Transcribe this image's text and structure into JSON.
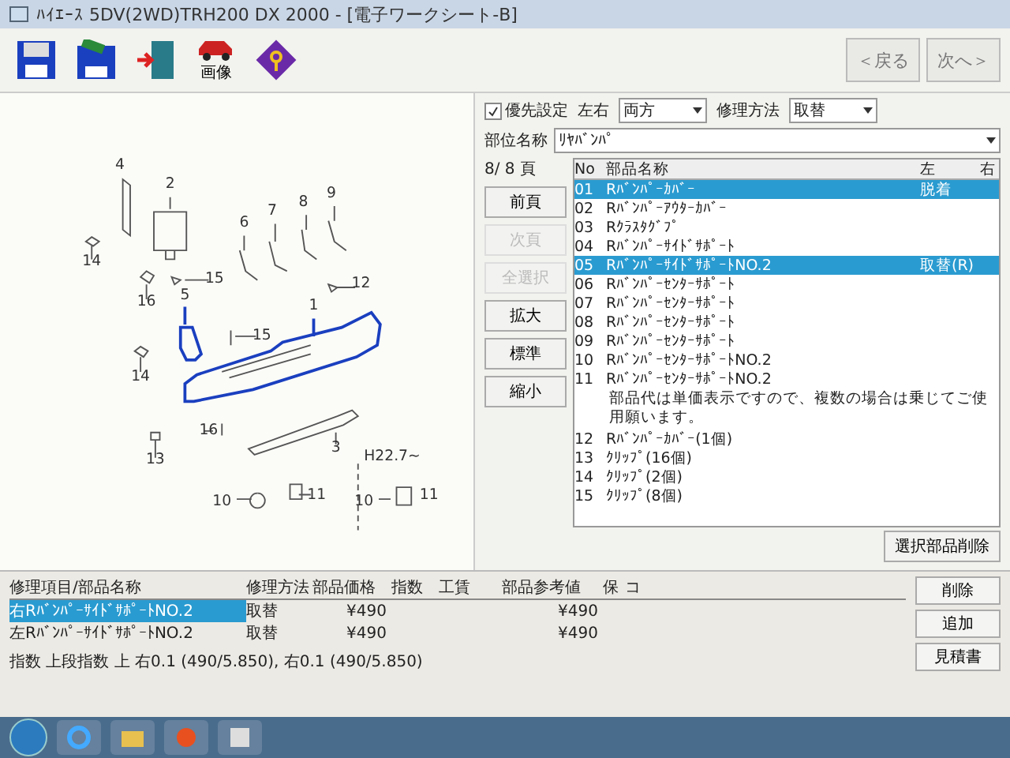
{
  "window": {
    "title": "ﾊｲｴｰｽ 5DV(2WD)TRH200 DX   2000 - [電子ワークシート-B]"
  },
  "toolbar": {
    "buttons": [
      {
        "kind": "save"
      },
      {
        "kind": "save_as"
      },
      {
        "kind": "exit"
      },
      {
        "kind": "image",
        "label": "画像"
      },
      {
        "kind": "manual"
      }
    ],
    "back": "＜戻る",
    "next": "次へ＞"
  },
  "options": {
    "priority": {
      "label": "優先設定",
      "checked": true
    },
    "side": {
      "label": "左右",
      "value": "両方"
    },
    "method": {
      "label": "修理方法",
      "value": "取替"
    }
  },
  "diagram": {
    "callouts": [
      "4",
      "2",
      "14",
      "6",
      "7",
      "8",
      "9",
      "16",
      "15",
      "12",
      "5",
      "1",
      "15",
      "14",
      "16",
      "13",
      "3",
      "10",
      "11",
      "10",
      "11"
    ],
    "note": "H22.7~"
  },
  "part_area": {
    "label": "部位名称",
    "value": "ﾘﾔﾊﾞﾝﾊﾟ"
  },
  "page": "8/ 8 頁",
  "side_buttons": [
    {
      "label": "前頁",
      "disabled": false
    },
    {
      "label": "次頁",
      "disabled": true
    },
    {
      "label": "全選択",
      "disabled": true
    },
    {
      "label": "拡大",
      "disabled": false
    },
    {
      "label": "標準",
      "disabled": false
    },
    {
      "label": "縮小",
      "disabled": false
    }
  ],
  "parts_list": {
    "columns": [
      "No",
      "部品名称",
      "左",
      "右"
    ],
    "rows": [
      {
        "kind": "part",
        "no": "01",
        "name": "Rﾊﾞﾝﾊﾟｰｶﾊﾞｰ",
        "status": "脱着",
        "selected": true
      },
      {
        "kind": "part",
        "no": "02",
        "name": "Rﾊﾞﾝﾊﾟｰｱｳﾀｰｶﾊﾞｰ",
        "selected": false
      },
      {
        "kind": "part",
        "no": "03",
        "name": "Rｸﾗｽﾀｸﾞﾌﾟ",
        "selected": false
      },
      {
        "kind": "part",
        "no": "04",
        "name": "Rﾊﾞﾝﾊﾟｰｻｲﾄﾞｻﾎﾟｰﾄ",
        "selected": false
      },
      {
        "kind": "part",
        "no": "05",
        "name": "RﾊﾞﾝﾊﾟｰｻｲﾄﾞｻﾎﾟｰﾄNO.2",
        "status": "取替(R)",
        "selected": true
      },
      {
        "kind": "part",
        "no": "06",
        "name": "Rﾊﾞﾝﾊﾟｰｾﾝﾀｰｻﾎﾟｰﾄ",
        "selected": false
      },
      {
        "kind": "part",
        "no": "07",
        "name": "Rﾊﾞﾝﾊﾟｰｾﾝﾀｰｻﾎﾟｰﾄ",
        "selected": false
      },
      {
        "kind": "part",
        "no": "08",
        "name": "Rﾊﾞﾝﾊﾟｰｾﾝﾀｰｻﾎﾟｰﾄ",
        "selected": false
      },
      {
        "kind": "part",
        "no": "09",
        "name": "Rﾊﾞﾝﾊﾟｰｾﾝﾀｰｻﾎﾟｰﾄ",
        "selected": false
      },
      {
        "kind": "part",
        "no": "10",
        "name": "RﾊﾞﾝﾊﾟｰｾﾝﾀｰｻﾎﾟｰﾄNO.2",
        "selected": false
      },
      {
        "kind": "part",
        "no": "11",
        "name": "RﾊﾞﾝﾊﾟｰｾﾝﾀｰｻﾎﾟｰﾄNO.2",
        "selected": false
      },
      {
        "kind": "note",
        "text": "部品代は単価表示ですので、複数の場合は乗じてご使用願います。"
      },
      {
        "kind": "part",
        "no": "12",
        "name": "Rﾊﾞﾝﾊﾟｰｶﾊﾞｰ(1個)",
        "selected": false
      },
      {
        "kind": "part",
        "no": "13",
        "name": "ｸﾘｯﾌﾟ(16個)",
        "selected": false
      },
      {
        "kind": "part",
        "no": "14",
        "name": "ｸﾘｯﾌﾟ(2個)",
        "selected": false
      },
      {
        "kind": "part",
        "no": "15",
        "name": "ｸﾘｯﾌﾟ(8個)",
        "selected": false
      }
    ]
  },
  "list_button": "選択部品削除",
  "estimate": {
    "columns": [
      "修理項目/部品名称",
      "修理方法",
      "部品価格",
      "指数",
      "工賃",
      "部品参考値",
      "保",
      "コ"
    ],
    "rows": [
      {
        "name": "右RﾊﾞﾝﾊﾟｰｻｲﾄﾞｻﾎﾟｰﾄNO.2",
        "method": "取替",
        "price": "¥490",
        "reference": "¥490",
        "selected": true
      },
      {
        "name": "左RﾊﾞﾝﾊﾟｰｻｲﾄﾞｻﾎﾟｰﾄNO.2",
        "method": "取替",
        "price": "¥490",
        "reference": "¥490",
        "selected": false
      }
    ],
    "summary": "指数 上段指数 上 右0.1 (490/5.850), 右0.1 (490/5.850)"
  },
  "estimate_buttons": [
    "削除",
    "追加",
    "見積書"
  ]
}
